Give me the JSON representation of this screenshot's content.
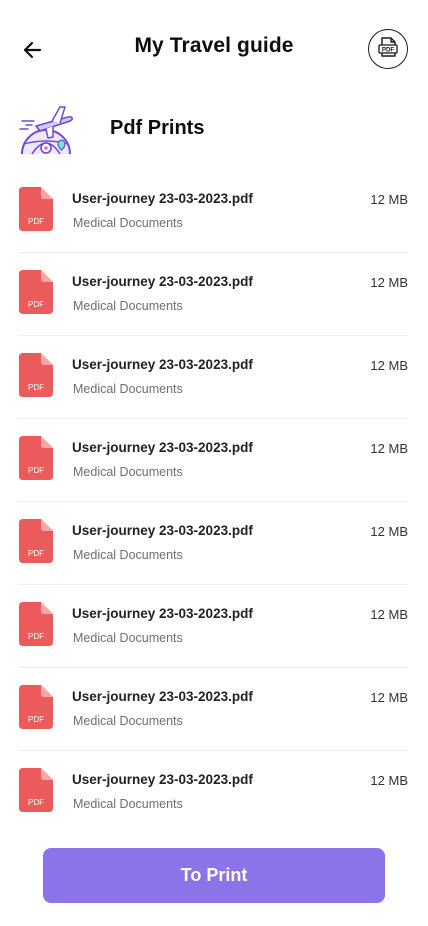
{
  "header": {
    "title": "My Travel guide",
    "back_icon": "arrow-left-icon",
    "pdf_button_icon": "pdf-icon",
    "pdf_button_label": "PDF"
  },
  "section": {
    "title": "Pdf Prints",
    "illustration": "airplane-globe-icon"
  },
  "files": [
    {
      "name": "User-journey 23-03-2023.pdf",
      "category": "Medical Documents",
      "size": "12 MB",
      "icon_label": "PDF"
    },
    {
      "name": "User-journey 23-03-2023.pdf",
      "category": "Medical Documents",
      "size": "12 MB",
      "icon_label": "PDF"
    },
    {
      "name": "User-journey 23-03-2023.pdf",
      "category": "Medical Documents",
      "size": "12 MB",
      "icon_label": "PDF"
    },
    {
      "name": "User-journey 23-03-2023.pdf",
      "category": "Medical Documents",
      "size": "12 MB",
      "icon_label": "PDF"
    },
    {
      "name": "User-journey 23-03-2023.pdf",
      "category": "Medical Documents",
      "size": "12 MB",
      "icon_label": "PDF"
    },
    {
      "name": "User-journey 23-03-2023.pdf",
      "category": "Medical Documents",
      "size": "12 MB",
      "icon_label": "PDF"
    },
    {
      "name": "User-journey 23-03-2023.pdf",
      "category": "Medical Documents",
      "size": "12 MB",
      "icon_label": "PDF"
    },
    {
      "name": "User-journey 23-03-2023.pdf",
      "category": "Medical Documents",
      "size": "12 MB",
      "icon_label": "PDF"
    }
  ],
  "actions": {
    "print_label": "To Print"
  },
  "colors": {
    "accent": "#8c73ea",
    "pdf_red": "#ec5b5b",
    "pdf_fold": "#f6a6a6"
  }
}
